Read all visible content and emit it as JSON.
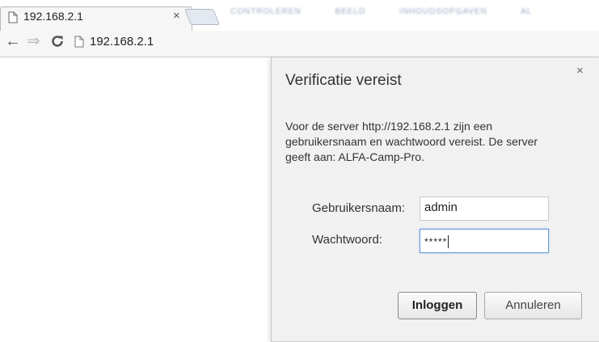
{
  "browser": {
    "tab": {
      "title": "192.168.2.1",
      "close_glyph": "×"
    },
    "background_tabs": [
      "CONTROLEREN",
      "BEELD",
      "INHOUDSOPGAVEN",
      "AL"
    ],
    "nav": {
      "back_glyph": "←",
      "forward_glyph": "⇒"
    },
    "address": "192.168.2.1"
  },
  "dialog": {
    "title": "Verificatie vereist",
    "close_glyph": "×",
    "message": "Voor de server http://192.168.2.1 zijn een gebruikersnaam en wachtwoord vereist. De server geeft aan: ALFA-Camp-Pro.",
    "username_label": "Gebruikersnaam:",
    "username_value": "admin",
    "password_label": "Wachtwoord:",
    "password_value": "*****",
    "login_button": "Inloggen",
    "cancel_button": "Annuleren"
  },
  "colors": {
    "focus_border": "#6a9bd8",
    "dialog_bg": "#f1f1f1",
    "toolbar_bg": "#f6f6f6"
  },
  "icons": [
    "page-icon",
    "back-arrow-icon",
    "forward-arrow-icon",
    "reload-icon",
    "close-icon"
  ]
}
